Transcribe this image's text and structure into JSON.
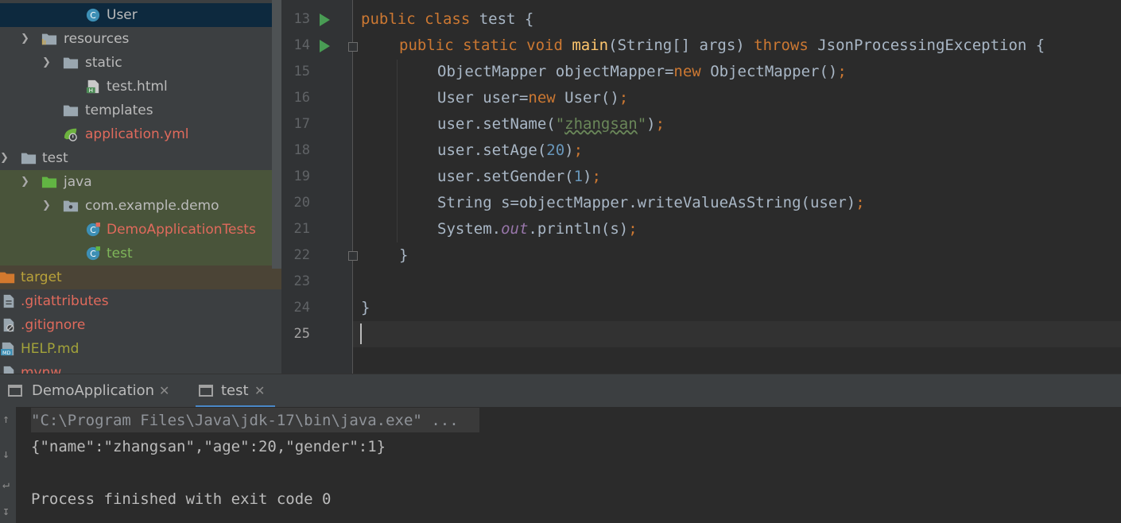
{
  "project_tree": {
    "items": [
      {
        "label": "User",
        "kind": "class",
        "color": "#bbbbbb"
      },
      {
        "label": "resources",
        "kind": "resources-folder",
        "color": "#bbbbbb"
      },
      {
        "label": "static",
        "kind": "folder",
        "color": "#bbbbbb"
      },
      {
        "label": "test.html",
        "kind": "html-file",
        "color": "#bbbbbb"
      },
      {
        "label": "templates",
        "kind": "folder",
        "color": "#bbbbbb"
      },
      {
        "label": "application.yml",
        "kind": "spring-config",
        "color": "#e06a5c"
      },
      {
        "label": "test",
        "kind": "folder",
        "color": "#bbbbbb"
      },
      {
        "label": "java",
        "kind": "test-source-folder",
        "color": "#bbbbbb"
      },
      {
        "label": "com.example.demo",
        "kind": "package",
        "color": "#bbbbbb"
      },
      {
        "label": "DemoApplicationTests",
        "kind": "test-class",
        "color": "#e06a5c"
      },
      {
        "label": "test",
        "kind": "test-class",
        "color": "#7fb65a"
      },
      {
        "label": "target",
        "kind": "excluded-folder",
        "color": "#b9a23a"
      },
      {
        "label": ".gitattributes",
        "kind": "text-file",
        "color": "#e06a5c"
      },
      {
        "label": ".gitignore",
        "kind": "ignore-file",
        "color": "#e06a5c"
      },
      {
        "label": "HELP.md",
        "kind": "markdown-file",
        "color": "#a3a33a"
      },
      {
        "label": "mvnw",
        "kind": "file",
        "color": "#e06a5c"
      }
    ]
  },
  "editor": {
    "line_numbers": [
      "13",
      "14",
      "15",
      "16",
      "17",
      "18",
      "19",
      "20",
      "21",
      "22",
      "23",
      "24",
      "25"
    ],
    "current_line": "25",
    "code": {
      "l13": {
        "t1": "public ",
        "t2": "class ",
        "t3": "test {"
      },
      "l14": {
        "t1": "public ",
        "t2": "static ",
        "t3": "void ",
        "t4": "main",
        "t5": "(String[] args) ",
        "t6": "throws ",
        "t7": "JsonProcessingException {"
      },
      "l15": {
        "t1": "ObjectMapper objectMapper=",
        "t2": "new ",
        "t3": "ObjectMapper()",
        "t4": ";"
      },
      "l16": {
        "t1": "User user=",
        "t2": "new ",
        "t3": "User()",
        "t4": ";"
      },
      "l17": {
        "t1": "user.setName(",
        "t2": "\"",
        "t3": "zhangsan",
        "t4": "\"",
        "t5": ")",
        "t6": ";"
      },
      "l18": {
        "t1": "user.setAge(",
        "t2": "20",
        "t3": ")",
        "t4": ";"
      },
      "l19": {
        "t1": "user.setGender(",
        "t2": "1",
        "t3": ")",
        "t4": ";"
      },
      "l20": {
        "t1": "String s=objectMapper.writeValueAsString(user)",
        "t2": ";"
      },
      "l21": {
        "t1": "System.",
        "t2": "out",
        "t3": ".println(s)",
        "t4": ";"
      },
      "l22": {
        "t1": "}"
      },
      "l24": {
        "t1": "}"
      }
    }
  },
  "run_panel": {
    "tabs": [
      {
        "label": "DemoApplication",
        "active": false
      },
      {
        "label": "test",
        "active": true
      }
    ],
    "console_lines": [
      "\"C:\\Program Files\\Java\\jdk-17\\bin\\java.exe\" ...",
      "{\"name\":\"zhangsan\",\"age\":20,\"gender\":1}",
      "",
      "Process finished with exit code 0"
    ]
  },
  "colors": {
    "keyword": "#cc7832",
    "method_decl": "#ffc66d",
    "string": "#6a8759",
    "number": "#6897bb",
    "static_field": "#9876aa",
    "run_icon": "#499c54",
    "active_tab_underline": "#4a88c7"
  }
}
